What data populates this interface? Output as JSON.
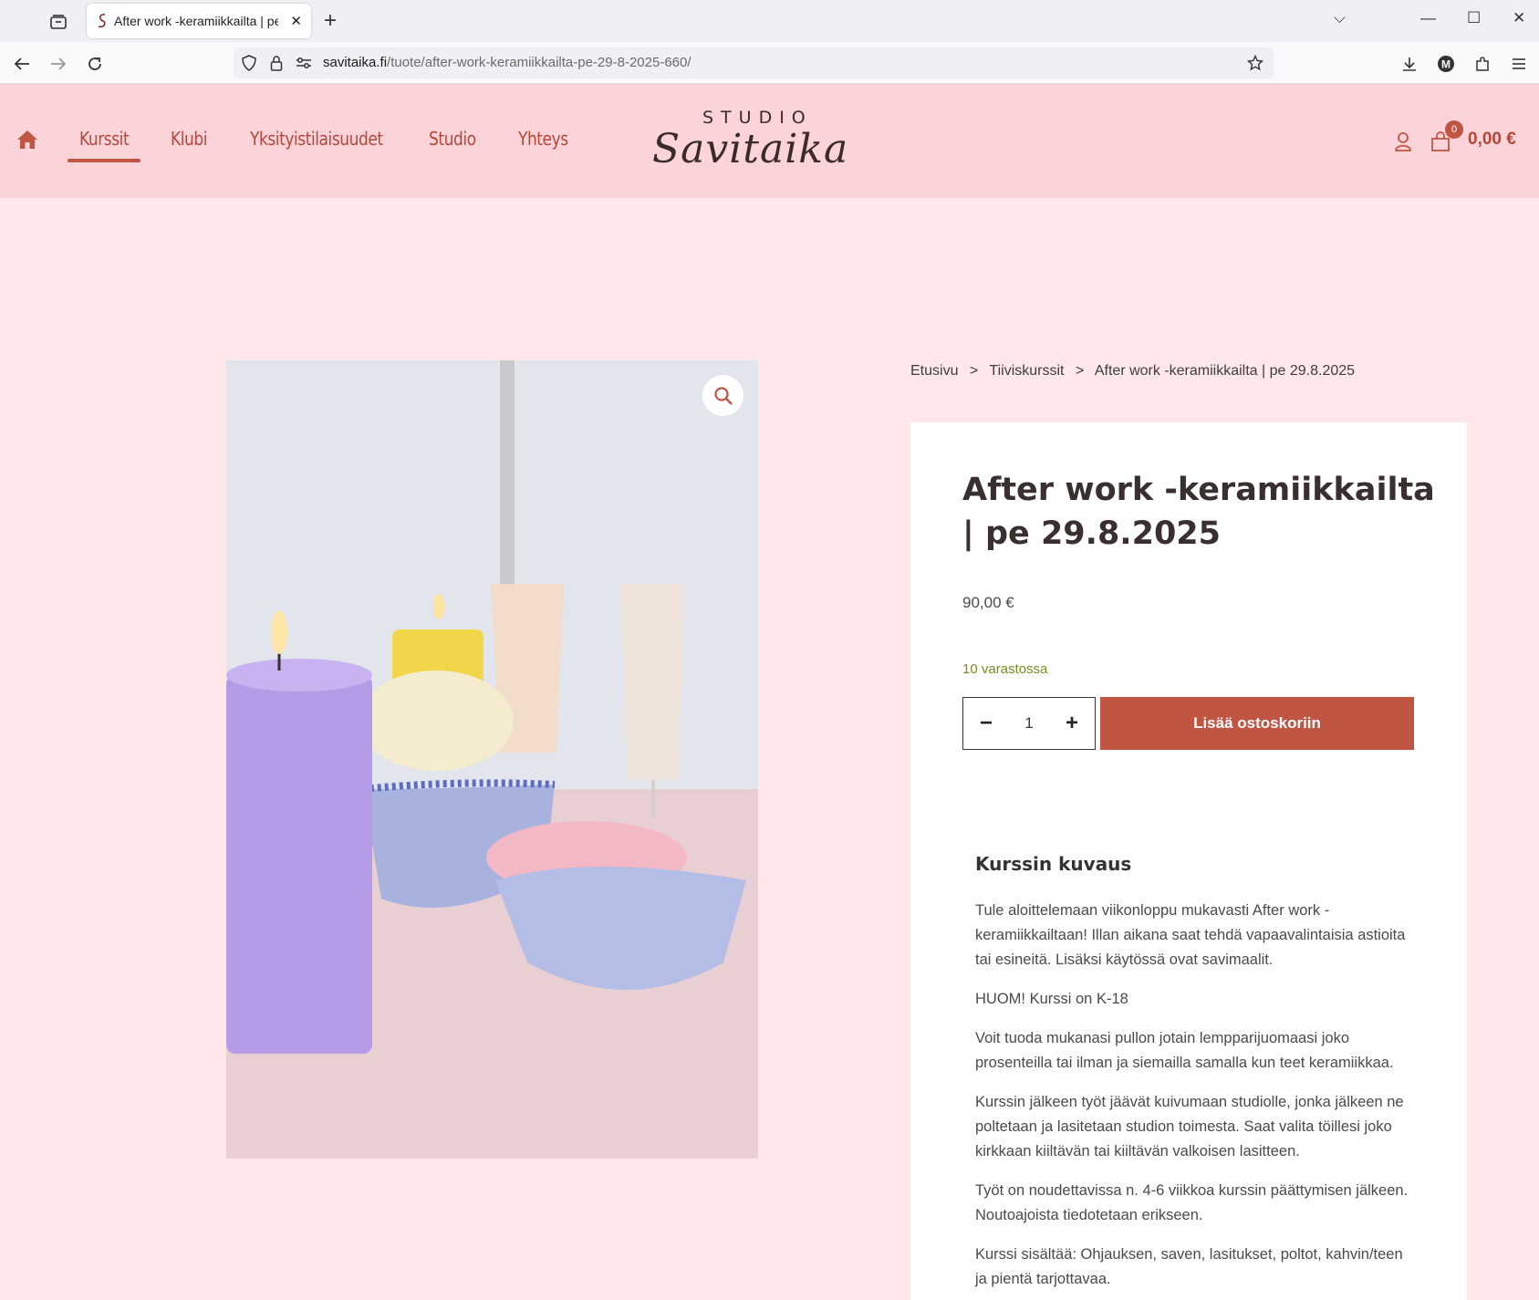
{
  "browser": {
    "tab_title": "After work -keramiikkailta | pe 29.8.2025",
    "url_host": "savitaika.fi",
    "url_path": "/tuote/after-work-keramiikkailta-pe-29-8-2025-660/",
    "new_tab_glyph": "+",
    "close_glyph": "✕"
  },
  "header": {
    "menu": [
      "Kurssit",
      "Klubi",
      "Yksityistilaisuudet",
      "Studio",
      "Yhteys"
    ],
    "active_menu": "Kurssit",
    "logo_top": "STUDIO",
    "logo_script": "Savitaika",
    "cart_count": "0",
    "cart_total": "0,00 €",
    "accent_color": "#c05544",
    "header_bg": "#fbd3d8"
  },
  "breadcrumb": [
    "Etusivu",
    ">",
    "Tiiviskurssit",
    ">",
    "After work -keramiikkailta | pe 29.8.2025"
  ],
  "product": {
    "title": "After work -keramiikkailta | pe 29.8.2025",
    "price": "90,00 €",
    "stock": "10 varastossa",
    "quantity": "1",
    "minus": "−",
    "plus": "+",
    "add_to_cart": "Lisää ostoskoriin"
  },
  "description": {
    "heading": "Kurssin kuvaus",
    "paragraphs": [
      "Tule aloittelemaan viikonloppu mukavasti After work -keramiikkailtaan! Illan aikana saat tehdä vapaavalintaisia astioita tai esineitä. Lisäksi käytössä ovat savimaalit.",
      "HUOM! Kurssi on K-18",
      "Voit tuoda mukanasi pullon jotain lempparijuomaasi joko prosenteilla tai ilman ja siemailla samalla kun teet keramiikkaa.",
      "Kurssin jälkeen työt jäävät kuivumaan studiolle, jonka jälkeen ne poltetaan ja lasitetaan studion toimesta. Saat valita töillesi joko kirkkaan kiiltävän tai kiiltävän valkoisen lasitteen.",
      "Työt on noudettavissa n. 4-6 viikkoa kurssin päättymisen jälkeen. Noutoajoista tiedotetaan erikseen.",
      "Kurssi sisältää: Ohjauksen, saven, lasitukset, poltot, kahvin/teen ja pientä tarjottavaa."
    ]
  },
  "icons": [
    "tab-list-icon",
    "back-icon",
    "forward-icon",
    "reload-icon",
    "shield-icon",
    "lock-icon",
    "permissions-icon",
    "bookmark-star-icon",
    "download-icon",
    "account-icon",
    "extensions-icon",
    "menu-icon",
    "home-icon",
    "user-icon",
    "cart-icon",
    "zoom-icon"
  ]
}
